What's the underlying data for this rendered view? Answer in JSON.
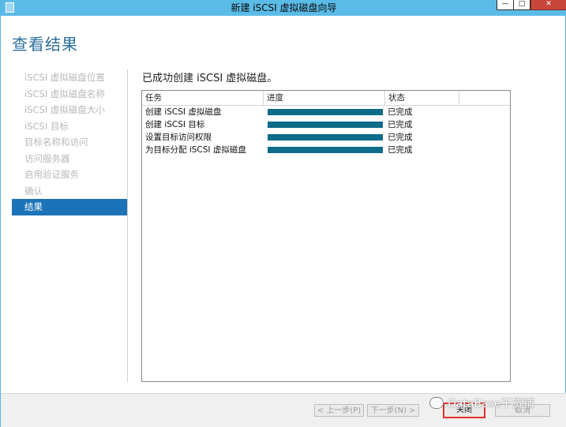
{
  "window": {
    "title": "新建 iSCSI 虚拟磁盘向导",
    "buttons": {
      "minimize": "—",
      "maximize": "□",
      "close": "✕"
    }
  },
  "page": {
    "title": "查看结果",
    "heading": "已成功创建 iSCSI 虚拟磁盘。"
  },
  "nav": {
    "items": [
      {
        "label": "iSCSI 虚拟磁盘位置",
        "active": false
      },
      {
        "label": "iSCSI 虚拟磁盘名称",
        "active": false
      },
      {
        "label": "iSCSI 虚拟磁盘大小",
        "active": false
      },
      {
        "label": "iSCSI 目标",
        "active": false
      },
      {
        "label": "目标名称和访问",
        "active": false
      },
      {
        "label": "访问服务器",
        "active": false
      },
      {
        "label": "启用验证服务",
        "active": false
      },
      {
        "label": "确认",
        "active": false
      },
      {
        "label": "结果",
        "active": true
      }
    ]
  },
  "table": {
    "columns": [
      "任务",
      "进度",
      "状态",
      ""
    ],
    "rows": [
      {
        "task": "创建 iSCSI 虚拟磁盘",
        "progress": 100,
        "status": "已完成"
      },
      {
        "task": "创建 iSCSI 目标",
        "progress": 100,
        "status": "已完成"
      },
      {
        "task": "设置目标访问权限",
        "progress": 100,
        "status": "已完成"
      },
      {
        "task": "为目标分配 iSCSI 虚拟磁盘",
        "progress": 100,
        "status": "已完成"
      }
    ]
  },
  "footer": {
    "prev": "< 上一步(P)",
    "next": "下一步(N) >",
    "close": "关闭",
    "cancel": "取消"
  },
  "watermark": {
    "text": "DataBase干货铺",
    "icon": "wechat-icon"
  },
  "colors": {
    "titlebar": "#5bbbe7",
    "accent": "#1d73b7",
    "progress": "#0e6b8a",
    "highlight": "#e2312b"
  }
}
